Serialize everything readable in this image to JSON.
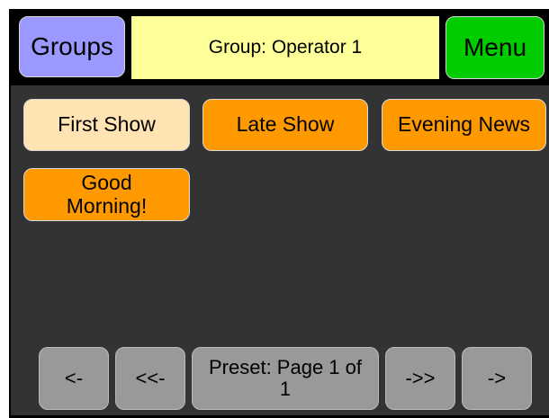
{
  "header": {
    "groups_label": "Groups",
    "group_title": "Group: Operator 1",
    "menu_label": "Menu"
  },
  "presets": [
    {
      "label": "First Show",
      "active": true
    },
    {
      "label": "Late Show",
      "active": false
    },
    {
      "label": "Evening News",
      "active": false
    },
    {
      "label": "Good Morning!",
      "active": false
    }
  ],
  "nav": {
    "prev_label": "<-",
    "first_label": "<<-",
    "page_label": "Preset: Page 1 of 1",
    "last_label": "->>",
    "next_label": "->"
  },
  "colors": {
    "groups_button": "#9999ff",
    "group_title_bg": "#ffff99",
    "menu_button": "#00cc00",
    "preset_button": "#ff9900",
    "preset_selected": "#ffe3b3",
    "nav_button": "#999999",
    "panel_bg": "#333333"
  }
}
